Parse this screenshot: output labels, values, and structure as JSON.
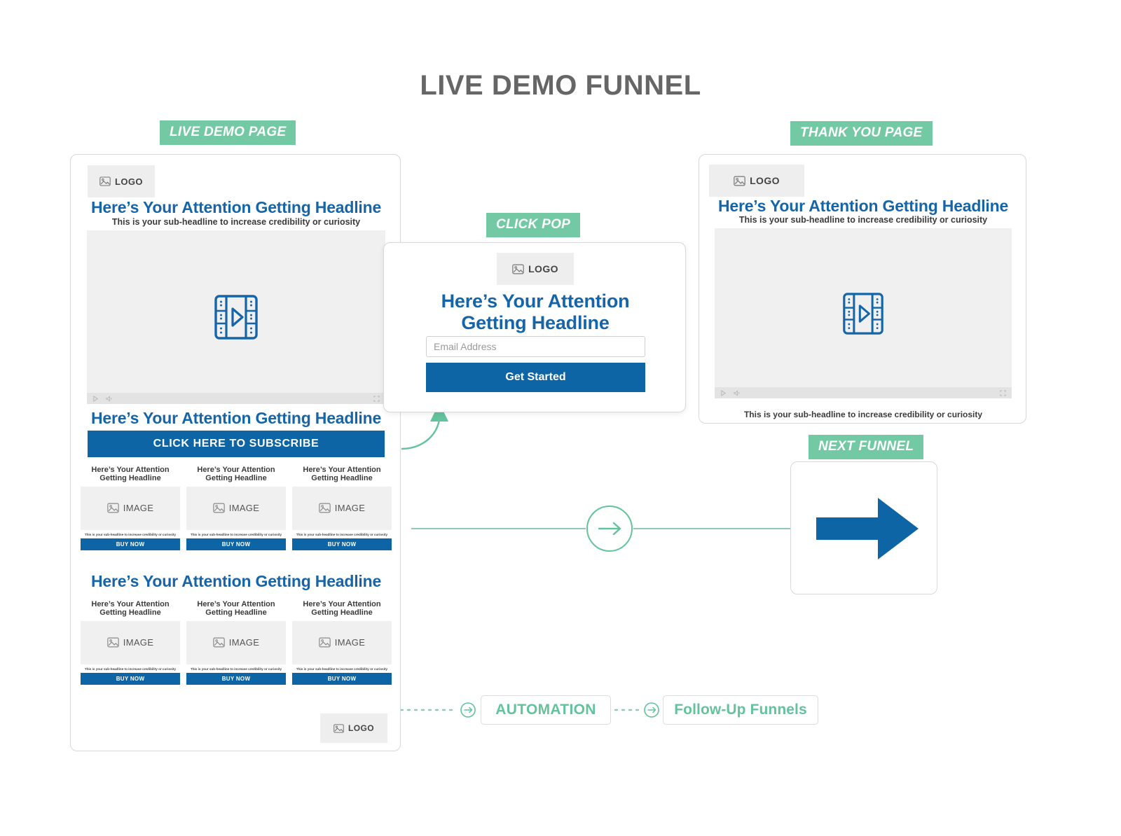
{
  "title": "LIVE DEMO FUNNEL",
  "colors": {
    "brand_blue": "#0d65a5",
    "headline_blue": "#1565a8",
    "accent_green": "#74c9a5",
    "flow_green": "#62c39c",
    "title_gray": "#666666"
  },
  "labels": {
    "live_demo_page": "LIVE DEMO PAGE",
    "thank_you_page": "THANK YOU PAGE",
    "click_pop": "CLICK POP",
    "next_funnel": "NEXT FUNNEL"
  },
  "common": {
    "logo": "LOGO",
    "image": "IMAGE",
    "headline": "Here’s Your Attention Getting Headline",
    "subheadline": "This is your sub-headline to increase credibility or curiosity",
    "buy_now": "BUY NOW"
  },
  "demo_page": {
    "logo": "LOGO",
    "headline": "Here’s Your Attention Getting Headline",
    "subheadline": "This is your sub-headline to increase credibility or curiosity",
    "cta_headline": "Here’s Your Attention Getting Headline",
    "cta_button": "CLICK HERE TO SUBSCRIBE",
    "section2_headline": "Here’s Your Attention Getting Headline",
    "footer_logo": "LOGO",
    "cards_row1": [
      {
        "title": "Here’s Your Attention Getting Headline",
        "image": "IMAGE",
        "sub": "This is your sub-headline to increase credibility or curiosity",
        "button": "BUY NOW"
      },
      {
        "title": "Here’s Your Attention Getting Headline",
        "image": "IMAGE",
        "sub": "This is your sub-headline to increase credibility or curiosity",
        "button": "BUY NOW"
      },
      {
        "title": "Here’s Your Attention Getting Headline",
        "image": "IMAGE",
        "sub": "This is your sub-headline to increase credibility or curiosity",
        "button": "BUY NOW"
      }
    ],
    "cards_row2": [
      {
        "title": "Here’s Your Attention Getting Headline",
        "image": "IMAGE",
        "sub": "This is your sub-headline to increase credibility or curiosity",
        "button": "BUY NOW"
      },
      {
        "title": "Here’s Your Attention Getting Headline",
        "image": "IMAGE",
        "sub": "This is your sub-headline to increase credibility or curiosity",
        "button": "BUY NOW"
      },
      {
        "title": "Here’s Your Attention Getting Headline",
        "image": "IMAGE",
        "sub": "This is your sub-headline to increase credibility or curiosity",
        "button": "BUY NOW"
      }
    ]
  },
  "click_pop": {
    "logo": "LOGO",
    "headline_line1": "Here’s Your Attention",
    "headline_line2": "Getting Headline",
    "email_placeholder": "Email Address",
    "email_value": "",
    "submit_button": "Get Started"
  },
  "thank_you_page": {
    "logo": "LOGO",
    "headline": "Here’s Your Attention Getting Headline",
    "subheadline": "This is your sub-headline to increase credibility or curiosity",
    "footer_subheadline": "This is your sub-headline to increase credibility or curiosity"
  },
  "flow": {
    "automation": "AUTOMATION",
    "follow_up_funnels": "Follow-Up Funnels"
  }
}
